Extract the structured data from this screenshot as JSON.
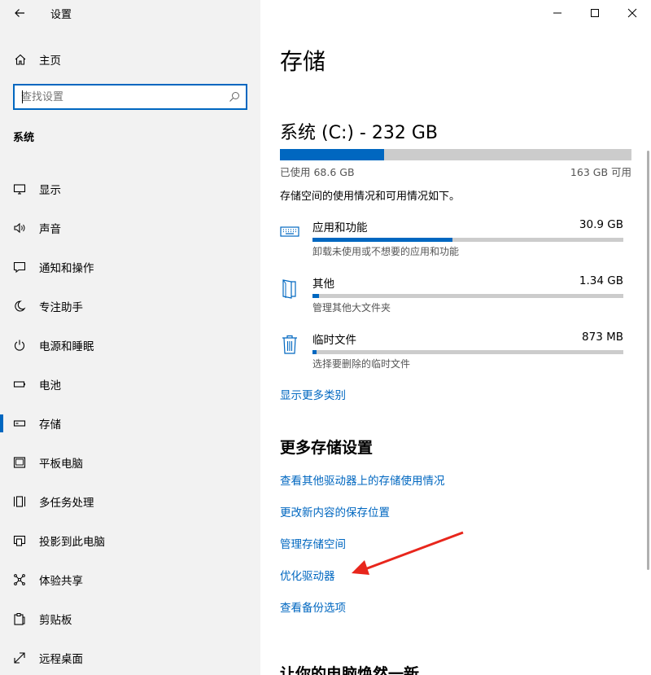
{
  "app": {
    "title": "设置"
  },
  "sidebar": {
    "home_label": "主页",
    "search_placeholder": "查找设置",
    "section": "系统",
    "items": [
      {
        "label": "显示",
        "icon": "monitor-icon"
      },
      {
        "label": "声音",
        "icon": "speaker-icon"
      },
      {
        "label": "通知和操作",
        "icon": "notification-icon"
      },
      {
        "label": "专注助手",
        "icon": "moon-icon"
      },
      {
        "label": "电源和睡眠",
        "icon": "power-icon"
      },
      {
        "label": "电池",
        "icon": "battery-icon"
      },
      {
        "label": "存储",
        "icon": "storage-icon",
        "active": true
      },
      {
        "label": "平板电脑",
        "icon": "tablet-icon"
      },
      {
        "label": "多任务处理",
        "icon": "multitask-icon"
      },
      {
        "label": "投影到此电脑",
        "icon": "project-icon"
      },
      {
        "label": "体验共享",
        "icon": "share-icon"
      },
      {
        "label": "剪贴板",
        "icon": "clipboard-icon"
      },
      {
        "label": "远程桌面",
        "icon": "remote-icon"
      }
    ]
  },
  "main": {
    "title": "存储",
    "drive": {
      "title": "系统 (C:) - 232 GB",
      "used_label": "已使用 68.6 GB",
      "free_label": "163 GB 可用",
      "used_fraction": 0.296
    },
    "description": "存储空间的使用情况和可用情况如下。",
    "categories": [
      {
        "name": "应用和功能",
        "size": "30.9 GB",
        "sub": "卸载未使用或不想要的应用和功能",
        "fraction": 0.45,
        "icon": "keyboard-icon"
      },
      {
        "name": "其他",
        "size": "1.34 GB",
        "sub": "管理其他大文件夹",
        "fraction": 0.02,
        "icon": "folder-icon"
      },
      {
        "name": "临时文件",
        "size": "873 MB",
        "sub": "选择要删除的临时文件",
        "fraction": 0.013,
        "icon": "trash-icon"
      }
    ],
    "show_more": "显示更多类别",
    "more_settings_title": "更多存储设置",
    "links": [
      "查看其他驱动器上的存储使用情况",
      "更改新内容的保存位置",
      "管理存储空间",
      "优化驱动器",
      "查看备份选项"
    ],
    "bottom_title": "让你的电脑焕然一新"
  }
}
